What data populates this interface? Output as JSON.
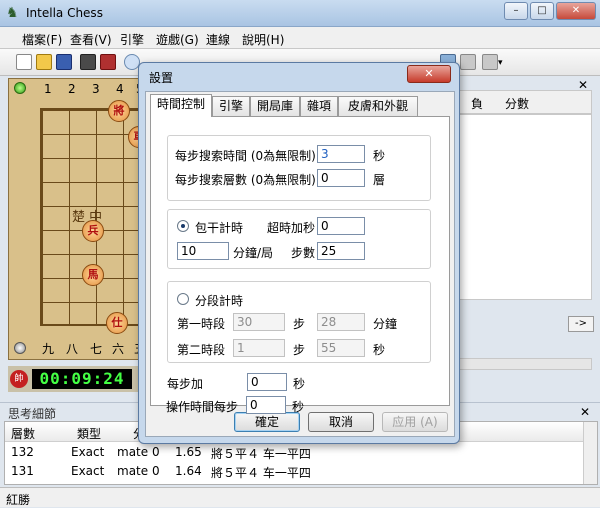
{
  "app": {
    "title": "Intella Chess",
    "icon": "knight-icon"
  },
  "window_buttons": {
    "min": "–",
    "max": "□",
    "close": "✕"
  },
  "menu": [
    "檔案(F)",
    "查看(V)",
    "引擎",
    "遊戲(G)",
    "連線",
    "說明(H)"
  ],
  "board": {
    "top_digits": [
      "1",
      "2",
      "3",
      "4",
      "5"
    ],
    "bottom_digits": [
      "九",
      "八",
      "七",
      "六",
      "五"
    ],
    "pieces": [
      "將",
      "兵",
      "馬",
      "仕",
      "車"
    ],
    "river_text": "楚 中"
  },
  "clock": {
    "badge": "帥",
    "time": "00:09:24"
  },
  "right_panel": {
    "col1": "負",
    "col2": "分數",
    "close": "✕",
    "arrow": "->"
  },
  "thinking": {
    "title": "思考細節",
    "close": "✕",
    "columns": [
      "層數",
      "類型",
      "分"
    ],
    "rows": [
      {
        "depth": "132",
        "type": "Exact",
        "score": "mate 0",
        "time": "1.65",
        "pv": "將５平４ 车一平四"
      },
      {
        "depth": "131",
        "type": "Exact",
        "score": "mate 0",
        "time": "1.64",
        "pv": "將５平４ 车一平四"
      }
    ]
  },
  "status": "紅勝",
  "dialog": {
    "title": "設置",
    "close": "✕",
    "tabs": [
      "時間控制",
      "引擎",
      "開局庫",
      "雜項",
      "皮膚和外觀"
    ],
    "search_time_label": "每步搜索時間 (0為無限制)",
    "search_time_value": "3",
    "search_time_unit": "秒",
    "search_depth_label": "每步搜索層數 (0為無限制)",
    "search_depth_value": "0",
    "search_depth_unit": "層",
    "bulk_label": "包干計時",
    "overtime_label": "超時加秒",
    "overtime_value": "0",
    "bulk_minutes_value": "10",
    "bulk_minutes_unit": "分鐘/局",
    "steps_label": "步數",
    "steps_value": "25",
    "stage_label": "分段計時",
    "stage1_label": "第一時段",
    "stage1_steps": "30",
    "stage1_steps_unit": "步",
    "stage1_minutes": "28",
    "stage1_minutes_unit": "分鐘",
    "stage2_label": "第二時段",
    "stage2_steps": "1",
    "stage2_steps_unit": "步",
    "stage2_seconds": "55",
    "stage2_seconds_unit": "秒",
    "increment_label": "每步加",
    "increment_value": "0",
    "increment_unit": "秒",
    "op_time_label": "操作時間每步",
    "op_time_value": "0",
    "op_time_unit": "秒",
    "ok": "確定",
    "cancel": "取消",
    "apply": "应用 (A)"
  }
}
